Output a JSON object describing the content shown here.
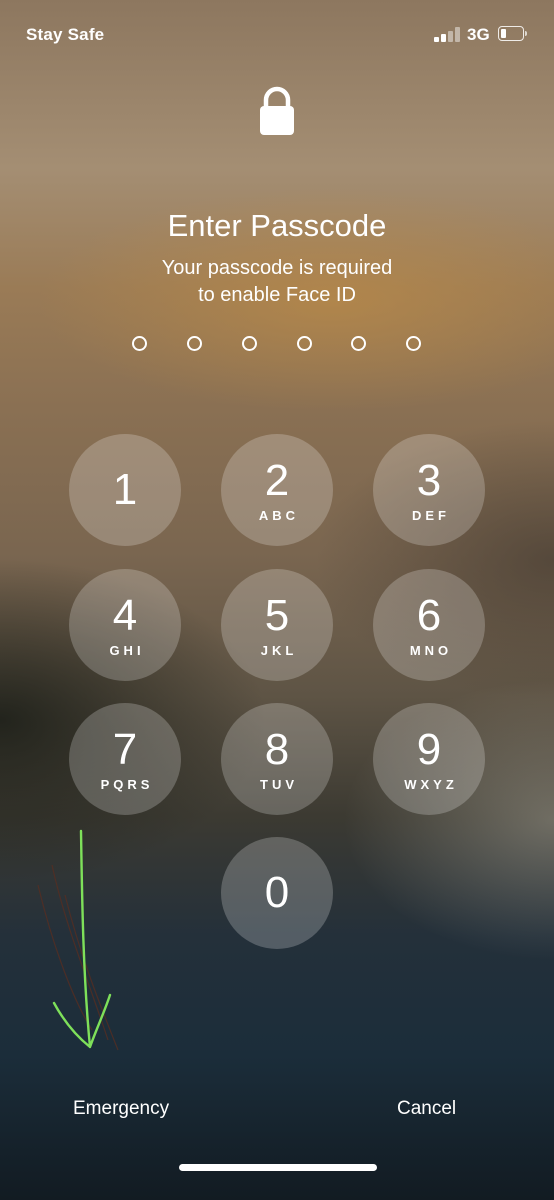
{
  "status_bar": {
    "carrier": "Stay Safe",
    "network": "3G",
    "signal_bars_filled": 2,
    "signal_bars_total": 4,
    "battery_level": 0.15
  },
  "lock": {
    "icon": "lock-icon"
  },
  "title": "Enter Passcode",
  "subtitle": {
    "line1": "Your passcode is required",
    "line2": "to enable Face ID"
  },
  "passcode": {
    "length": 6,
    "entered": 0
  },
  "keypad": [
    {
      "digit": "1",
      "letters": ""
    },
    {
      "digit": "2",
      "letters": "ABC"
    },
    {
      "digit": "3",
      "letters": "DEF"
    },
    {
      "digit": "4",
      "letters": "GHI"
    },
    {
      "digit": "5",
      "letters": "JKL"
    },
    {
      "digit": "6",
      "letters": "MNO"
    },
    {
      "digit": "7",
      "letters": "PQRS"
    },
    {
      "digit": "8",
      "letters": "TUV"
    },
    {
      "digit": "9",
      "letters": "WXYZ"
    },
    {
      "digit": "0",
      "letters": ""
    }
  ],
  "actions": {
    "emergency": "Emergency",
    "cancel": "Cancel"
  },
  "colors": {
    "annotation_arrow": "#7ee05a",
    "annotation_strokes": "#5a2e20"
  }
}
